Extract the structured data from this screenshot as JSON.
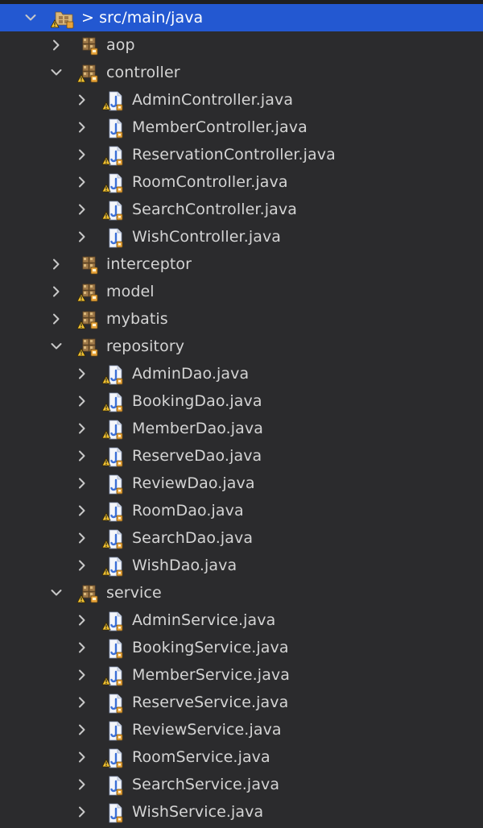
{
  "root": {
    "label": "> src/main/java",
    "expanded": true,
    "selected": true,
    "icon": "package-root-warning-icon"
  },
  "packages": [
    {
      "label": "aop",
      "expanded": false,
      "warning": false,
      "children": []
    },
    {
      "label": "controller",
      "expanded": true,
      "warning": true,
      "children": [
        {
          "label": "AdminController.java",
          "warning": true
        },
        {
          "label": "MemberController.java",
          "warning": false
        },
        {
          "label": "ReservationController.java",
          "warning": true
        },
        {
          "label": "RoomController.java",
          "warning": true
        },
        {
          "label": "SearchController.java",
          "warning": true
        },
        {
          "label": "WishController.java",
          "warning": false
        }
      ]
    },
    {
      "label": "interceptor",
      "expanded": false,
      "warning": false,
      "children": []
    },
    {
      "label": "model",
      "expanded": false,
      "warning": true,
      "children": []
    },
    {
      "label": "mybatis",
      "expanded": false,
      "warning": true,
      "children": []
    },
    {
      "label": "repository",
      "expanded": true,
      "warning": true,
      "children": [
        {
          "label": "AdminDao.java",
          "warning": true
        },
        {
          "label": "BookingDao.java",
          "warning": true
        },
        {
          "label": "MemberDao.java",
          "warning": true
        },
        {
          "label": "ReserveDao.java",
          "warning": true
        },
        {
          "label": "ReviewDao.java",
          "warning": false
        },
        {
          "label": "RoomDao.java",
          "warning": true
        },
        {
          "label": "SearchDao.java",
          "warning": true
        },
        {
          "label": "WishDao.java",
          "warning": true
        }
      ]
    },
    {
      "label": "service",
      "expanded": true,
      "warning": true,
      "children": [
        {
          "label": "AdminService.java",
          "warning": true
        },
        {
          "label": "BookingService.java",
          "warning": false
        },
        {
          "label": "MemberService.java",
          "warning": true
        },
        {
          "label": "ReserveService.java",
          "warning": false
        },
        {
          "label": "ReviewService.java",
          "warning": false
        },
        {
          "label": "RoomService.java",
          "warning": true
        },
        {
          "label": "SearchService.java",
          "warning": false
        },
        {
          "label": "WishService.java",
          "warning": false
        }
      ]
    }
  ],
  "colors": {
    "background": "#2b2b2d",
    "selection": "#2358d1",
    "text": "#d4d4d4",
    "chevron": "#c8c8c8",
    "package_brown": "#a07a4a",
    "package_light": "#d9b77a",
    "file_blue": "#3b6fd6",
    "warning_yellow": "#f1c232",
    "lock_orange": "#e8a33a"
  }
}
